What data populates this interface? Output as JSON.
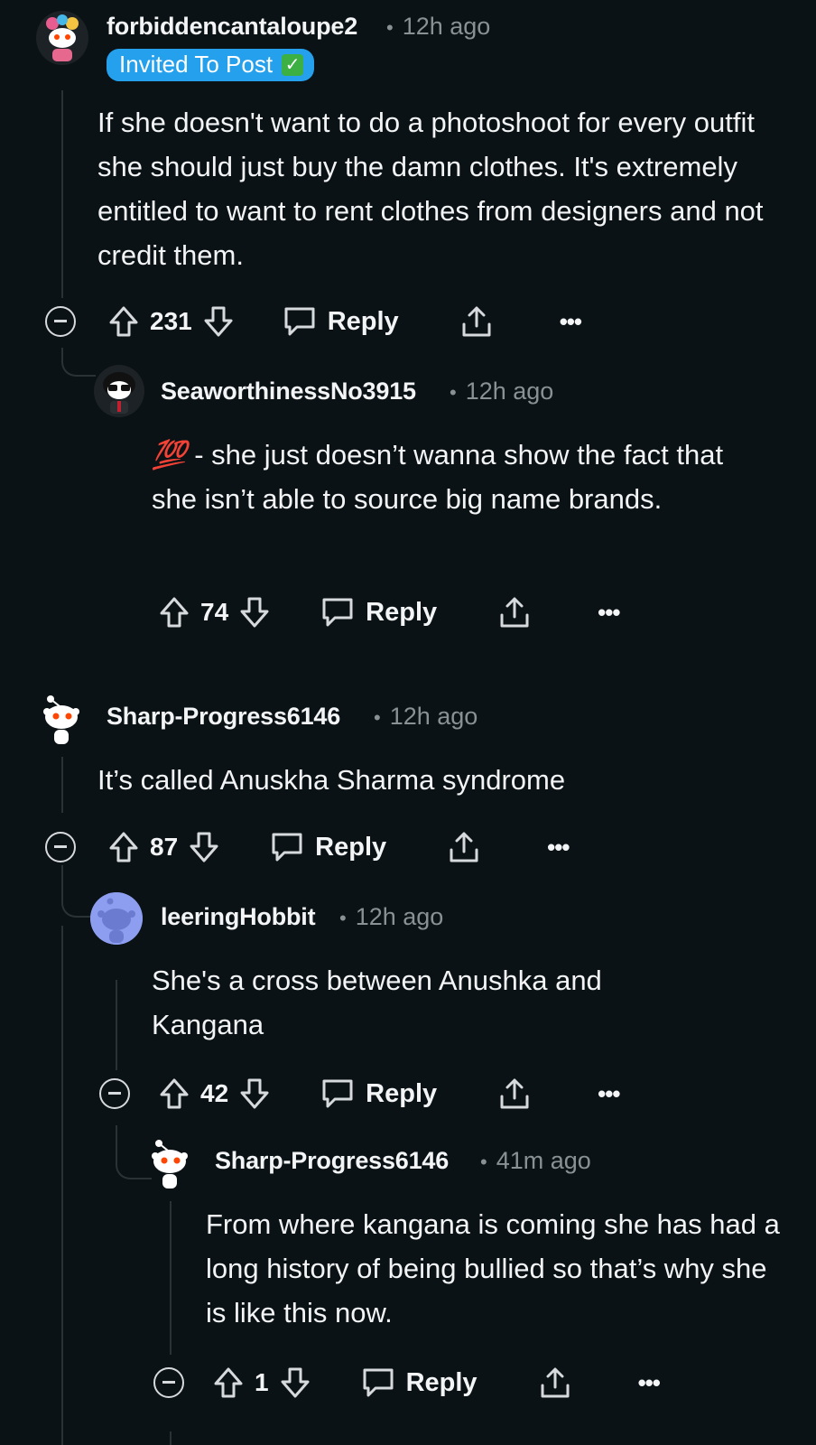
{
  "comments": [
    {
      "username": "forbiddencantaloupe2",
      "time": "12h ago",
      "flair": "Invited To Post",
      "flair_emoji": "check-mark-icon",
      "text": "If she doesn't want to do a photoshoot for every outfit she should just buy the damn clothes. It's extremely entitled to want to rent clothes from designers and not credit them.",
      "votes": "231",
      "reply_label": "Reply"
    },
    {
      "username": "SeaworthinessNo3915",
      "time": "12h ago",
      "emoji": "💯",
      "text": " - she just doesn’t wanna show the fact that she isn’t able to source big name brands.",
      "votes": "74",
      "reply_label": "Reply"
    },
    {
      "username": "Sharp-Progress6146",
      "time": "12h ago",
      "text": "It’s called Anuskha Sharma syndrome",
      "votes": "87",
      "reply_label": "Reply"
    },
    {
      "username": "leeringHobbit",
      "time": "12h ago",
      "text": "She's a cross between Anushka and Kangana",
      "votes": "42",
      "reply_label": "Reply"
    },
    {
      "username": "Sharp-Progress6146",
      "time": "41m ago",
      "text": "From where kangana is coming she has had a long history of being bullied so that’s why she is like this now.",
      "votes": "1",
      "reply_label": "Reply"
    }
  ],
  "colors": {
    "background": "#0b1215",
    "text": "#f2f4f5",
    "meta": "#8a9194",
    "flair": "#24a0ed",
    "thread_line": "#2b3236"
  }
}
